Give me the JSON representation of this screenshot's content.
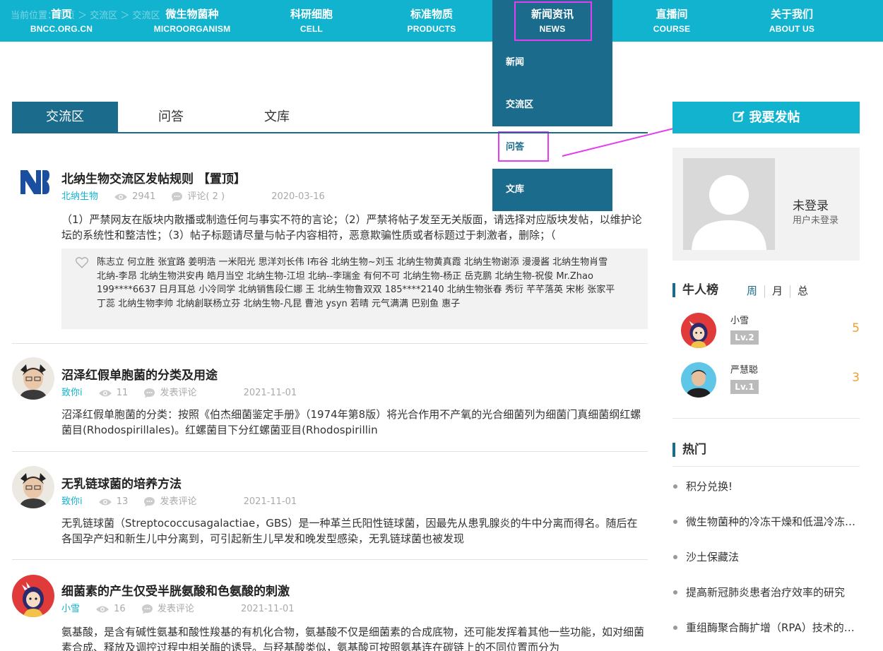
{
  "nav": {
    "ghost_crumb": "当前位置：首页 ＞ 交流区 ＞ 交流区",
    "items": [
      {
        "zh": "首页",
        "en": "BNCC.ORG.CN"
      },
      {
        "zh": "微生物菌种",
        "en": "MICROORGANISM"
      },
      {
        "zh": "科研细胞",
        "en": "CELL"
      },
      {
        "zh": "标准物质",
        "en": "PRODUCTS"
      },
      {
        "zh": "新闻资讯",
        "en": "NEWS"
      },
      {
        "zh": "直播间",
        "en": "COURSE"
      },
      {
        "zh": "关于我们",
        "en": "ABOUT US"
      }
    ],
    "dropdown": [
      "新闻",
      "交流区",
      "问答",
      "文库"
    ]
  },
  "tabs": [
    "交流区",
    "问答",
    "文库"
  ],
  "posts": [
    {
      "title": "北纳生物交流区发帖规则 【置顶】",
      "author": "北纳生物",
      "views": "2941",
      "comments": "评论( 2 )",
      "date": "2020-03-16",
      "summary": "（1）严禁网友在版块内散播或制造任何与事实不符的言论；（2）严禁将帖子发至无关版面，请选择对应版块发帖，以维护论坛的系统性和整洁性；（3）帖子标题请尽量与帖子内容相符，恶意欺骗性质或者标题过于刺激者，删除；（",
      "likes": "陈志立 何立胜 张宜路 姜明浩 一米阳光 思洋刘长伟 I布谷 北纳生物~刘玉 北纳生物黄真霞 北纳生物谢添 漫漫酱 北纳生物肖雪 北纳-李昂 北纳生物洪安冉 皓月当空 北纳生物-江坦 北纳--李瑞金 有何不可 北纳生物-杨正 岳克鹏 北纳生物-祝俊 Mr.Zhao 199****6637 日月耳总 小冷同学 北纳销售段仁娜 王 北纳生物鲁双双 185****2140 北纳生物张春 秀衍 芊芊落英 宋彬 张家平 丁蕊 北纳生物李帅 北納創联杨立芬 北纳生物-凡昆 曹池 ysyn 若晴 元气满满 巴别鱼 惠子"
    },
    {
      "title": "沼泽红假单胞菌的分类及用途",
      "author": "致你i",
      "views": "11",
      "comments": "发表评论",
      "date": "2021-11-01",
      "summary": "沼泽红假单胞菌的分类：按照《伯杰细菌鉴定手册》（1974年第8版）将光合作用不产氧的光合细菌列为细菌门真细菌纲红螺菌目(Rhodospirillales)。红螺菌目下分红螺菌亚目(Rhodospirillin"
    },
    {
      "title": "无乳链球菌的培养方法",
      "author": "致你i",
      "views": "13",
      "comments": "发表评论",
      "date": "2021-11-01",
      "summary": "无乳链球菌（Streptococcusagalactiae，GBS）是一种革兰氏阳性链球菌，因最先从患乳腺炎的牛中分离而得名。随后在各国孕产妇和新生儿中分离到，可引起新生儿早发和晚发型感染，无乳链球菌也被发现"
    },
    {
      "title": "细菌素的产生仅受半胱氨酸和色氨酸的刺激",
      "author": "小雪",
      "views": "16",
      "comments": "发表评论",
      "date": "2021-11-01",
      "summary": "氨基酸，是含有碱性氨基和酸性羧基的有机化合物，氨基酸不仅是细菌素的合成底物，还可能发挥着其他一些功能，如对细菌素合成、释放及调控过程中相关酶的诱导。与羟基酸类似，氨基酸可按照氨基连在碳链上的不同位置而分为"
    }
  ],
  "sidebar": {
    "post_button": "我要发帖",
    "user": {
      "name": "未登录",
      "sub": "用户未登录"
    },
    "ranking": {
      "title": "牛人榜",
      "tabs": [
        "周",
        "月",
        "总"
      ],
      "users": [
        {
          "name": "小雪",
          "level": "Lv.2",
          "score": "5"
        },
        {
          "name": "严慧聪",
          "level": "Lv.1",
          "score": "3"
        }
      ]
    },
    "hot": {
      "title": "热门",
      "items": [
        "积分兑换!",
        "微生物菌种的冷冻干燥和低温冷冻保藏",
        "沙土保藏法",
        "提高新冠肺炎患者治疗效率的研究",
        "重组酶聚合酶扩增（RPA）技术的原理与应用"
      ]
    }
  },
  "colors": {
    "cyan": "#12b3cf",
    "navy": "#1b6b8c",
    "highlight": "#e43cf0",
    "score": "#f0a030"
  }
}
